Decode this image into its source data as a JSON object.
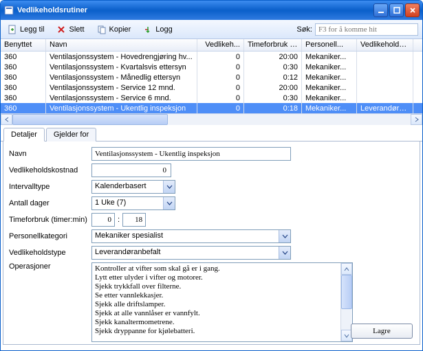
{
  "window": {
    "title": "Vedlikeholdsrutiner"
  },
  "toolbar": {
    "add_label": "Legg til",
    "delete_label": "Slett",
    "copy_label": "Kopier",
    "log_label": "Logg"
  },
  "search": {
    "label": "Søk:",
    "placeholder": "F3 for å komme hit"
  },
  "grid": {
    "columns": {
      "benyttet": "Benyttet",
      "navn": "Navn",
      "vedlikeh": "Vedlikeh...",
      "timeforbruk": "Timeforbruk (...",
      "personell": "Personell...",
      "type": "Vedlikeholdstype"
    },
    "rows": [
      {
        "benyttet": "360",
        "navn": "Ventilasjonssystem - Hovedrengjøring hv...",
        "vedlikeh": "0",
        "time": "20:00",
        "pers": "Mekaniker...",
        "type": ""
      },
      {
        "benyttet": "360",
        "navn": "Ventilasjonssystem - Kvartalsvis ettersyn",
        "vedlikeh": "0",
        "time": "0:30",
        "pers": "Mekaniker...",
        "type": ""
      },
      {
        "benyttet": "360",
        "navn": "Ventilasjonssystem - Månedlig ettersyn",
        "vedlikeh": "0",
        "time": "0:12",
        "pers": "Mekaniker...",
        "type": ""
      },
      {
        "benyttet": "360",
        "navn": "Ventilasjonssystem - Service 12 mnd.",
        "vedlikeh": "0",
        "time": "20:00",
        "pers": "Mekaniker...",
        "type": ""
      },
      {
        "benyttet": "360",
        "navn": "Ventilasjonssystem - Service 6 mnd.",
        "vedlikeh": "0",
        "time": "0:30",
        "pers": "Mekaniker...",
        "type": ""
      },
      {
        "benyttet": "360",
        "navn": "Ventilasjonssystem - Ukentlig inspeksjon",
        "vedlikeh": "0",
        "time": "0:18",
        "pers": "Mekaniker...",
        "type": "Leverandøranbe"
      }
    ],
    "selected_index": 5
  },
  "tabs": {
    "items": [
      "Detaljer",
      "Gjelder for"
    ],
    "active_index": 0
  },
  "form": {
    "labels": {
      "navn": "Navn",
      "kostnad": "Vedlikeholdskostnad",
      "intervalltype": "Intervalltype",
      "dager": "Antall dager",
      "timeforbruk": "Timeforbruk (timer:min)",
      "personell": "Personellkategori",
      "type": "Vedlikeholdstype",
      "operasjoner": "Operasjoner"
    },
    "values": {
      "navn": "Ventilasjonssystem - Ukentlig inspeksjon",
      "kostnad": "0",
      "intervalltype": "Kalenderbasert",
      "dager": "1 Uke (7)",
      "time_h": "0",
      "time_m": "18",
      "personell": "Mekaniker spesialist",
      "type": "Leverandøranbefalt"
    },
    "operasjoner": [
      "Kontroller at vifter som skal gå er i gang.",
      "Lytt etter ulyder i vifter og motorer.",
      "Sjekk trykkfall over filterne.",
      "Se etter vannlekkasjer.",
      "Sjekk alle driftslamper.",
      "Sjekk at alle vannlåser er vannfylt.",
      "Sjekk kanaltermometrene.",
      "Sjekk dryppanne for kjølebatteri."
    ],
    "save_label": "Lagre"
  }
}
